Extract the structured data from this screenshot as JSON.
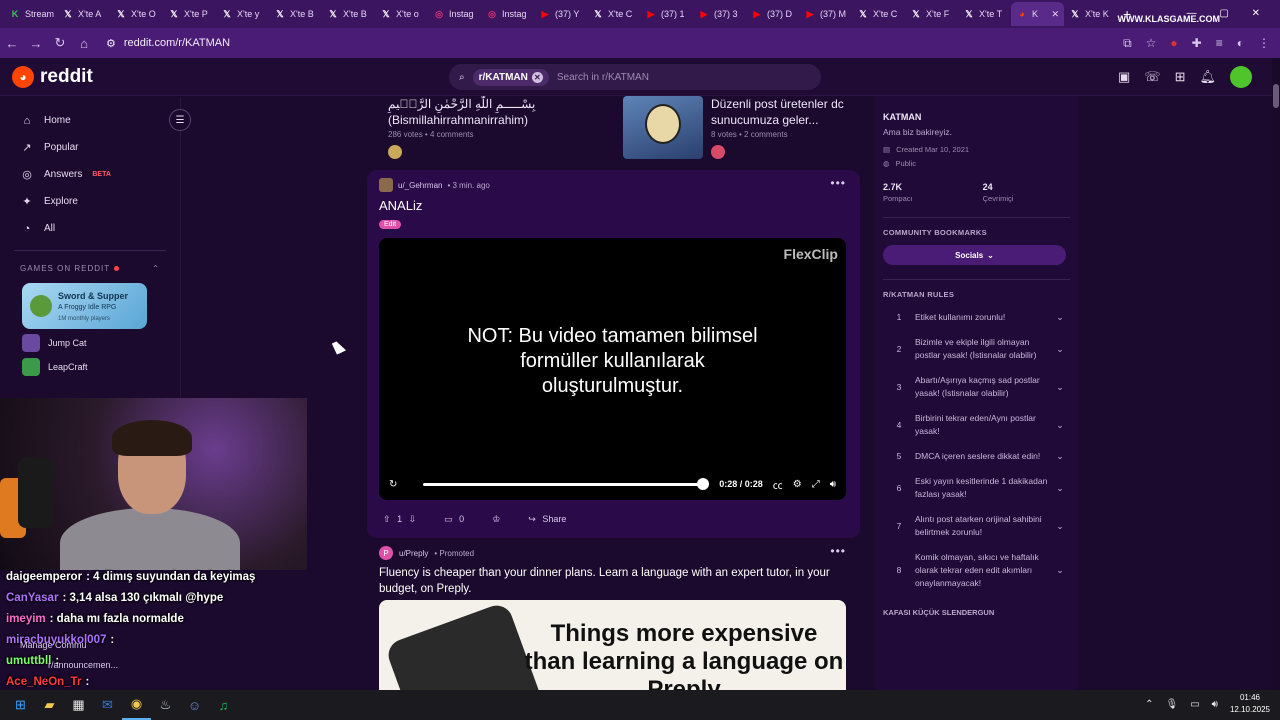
{
  "browser": {
    "tabs": [
      {
        "label": "Stream",
        "icon": "klas-icon",
        "color": "#2ecc40"
      },
      {
        "label": "X'te A",
        "icon": "x-icon",
        "color": "#ffffff"
      },
      {
        "label": "X'te O",
        "icon": "x-icon",
        "color": "#ffffff"
      },
      {
        "label": "X'te P",
        "icon": "x-icon",
        "color": "#ffffff"
      },
      {
        "label": "X'te y",
        "icon": "x-icon",
        "color": "#ffffff"
      },
      {
        "label": "X'te B",
        "icon": "x-icon",
        "color": "#ffffff"
      },
      {
        "label": "X'te B",
        "icon": "x-icon",
        "color": "#ffffff"
      },
      {
        "label": "X'te o",
        "icon": "x-icon",
        "color": "#ffffff"
      },
      {
        "label": "Instag",
        "icon": "instagram-icon",
        "color": "#e1306c"
      },
      {
        "label": "Instag",
        "icon": "instagram-icon",
        "color": "#e1306c"
      },
      {
        "label": "(37) Y",
        "icon": "youtube-icon",
        "color": "#ff0000"
      },
      {
        "label": "X'te C",
        "icon": "x-icon",
        "color": "#ffffff"
      },
      {
        "label": "(37) 1",
        "icon": "youtube-icon",
        "color": "#ff0000"
      },
      {
        "label": "(37) 3",
        "icon": "youtube-icon",
        "color": "#ff0000"
      },
      {
        "label": "(37) D",
        "icon": "youtube-icon",
        "color": "#ff0000"
      },
      {
        "label": "(37) M",
        "icon": "youtube-icon",
        "color": "#ff0000"
      },
      {
        "label": "X'te C",
        "icon": "x-icon",
        "color": "#ffffff"
      },
      {
        "label": "X'te F",
        "icon": "x-icon",
        "color": "#ffffff"
      },
      {
        "label": "X'te T",
        "icon": "x-icon",
        "color": "#ffffff"
      },
      {
        "label": "K",
        "icon": "reddit-icon",
        "color": "#ff4500",
        "active": true
      },
      {
        "label": "X'te K",
        "icon": "x-icon",
        "color": "#ffffff"
      }
    ],
    "brand_overlay": "WWW.KLASGAME.COM",
    "url": "reddit.com/r/KATMAN"
  },
  "header": {
    "logo_text": "reddit",
    "search_chip": "r/KATMAN",
    "search_placeholder": "Search in r/KATMAN",
    "notif_count": "1"
  },
  "left_nav": {
    "items": [
      {
        "label": "Home",
        "icon": "home-icon",
        "glyph": "⌂"
      },
      {
        "label": "Popular",
        "icon": "popular-icon",
        "glyph": "↗"
      },
      {
        "label": "Answers",
        "icon": "answers-icon",
        "glyph": "◎",
        "badge": "BETA"
      },
      {
        "label": "Explore",
        "icon": "explore-icon",
        "glyph": "✦"
      },
      {
        "label": "All",
        "icon": "all-icon",
        "glyph": "◔"
      }
    ],
    "games_header": "GAMES ON REDDIT",
    "featured_game": {
      "title": "Sword & Supper",
      "subtitle": "A Froggy Idle RPG",
      "players": "1M monthly players"
    },
    "games": [
      {
        "label": "Jump Cat",
        "color": "#6a4aa0"
      },
      {
        "label": "LeapCraft",
        "color": "#3a9a4a"
      }
    ]
  },
  "chat": {
    "lines": [
      {
        "user": "daigeemperor",
        "text": ": 4 dimış suyundan da keyimaş",
        "color": "#ffffff"
      },
      {
        "user": "CanYasar",
        "text": ": 3,14 alsa 130 çıkmalı @hype",
        "color": "#b070ff"
      },
      {
        "user": "imeyim",
        "text": ": daha mı fazla normalde",
        "color": "#ff6ad0"
      },
      {
        "user": "miracbuyukkol007",
        "text": ":",
        "color": "#b070ff"
      },
      {
        "user": "umuttbll",
        "text": ":",
        "color": "#7cff6a"
      },
      {
        "user": "Ace_NeOn_Tr",
        "text": ":",
        "color": "#ff3a3a"
      }
    ],
    "bg_items": [
      "Manage Commu",
      "r/announcemen..."
    ]
  },
  "feed": {
    "prev_left": {
      "title": "بِسْـــــمِ اللّٰهِ الرَّحْمٰنِ الرَّح۪يمِ (Bismillahirrahmanirrahim)",
      "meta": "286 votes • 4 comments"
    },
    "prev_right": {
      "title": "Düzenli post üretenler dc sunucumuza geler...",
      "meta": "8 votes • 2 comments"
    },
    "post": {
      "user": "u/_Gehrman",
      "time": "• 3 min. ago",
      "title": "ANALiz",
      "flair": "Edit",
      "watermark": "FlexClip",
      "video_text": "NOT: Bu video tamamen bilimsel formüller kullanılarak oluşturulmuştur.",
      "time_display": "0:28 / 0:28",
      "progress": 1.0,
      "votes": "1",
      "comments": "0",
      "share_label": "Share"
    },
    "promo": {
      "user": "u/Preply",
      "tag": "• Promoted",
      "title": "Fluency is cheaper than your dinner plans. Learn a language with an expert tutor, in your budget, on Preply.",
      "image_text": "Things more expensive than learning a language on Preply"
    }
  },
  "community": {
    "name": "KATMAN",
    "description": "Ama biz bakireyiz.",
    "created": "Created Mar 10, 2021",
    "visibility": "Public",
    "members": "2.7K",
    "members_label": "Pompacı",
    "online": "24",
    "online_label": "Çevrimiçi",
    "bookmarks_header": "COMMUNITY BOOKMARKS",
    "socials_label": "Socials",
    "rules_header": "R/KATMAN RULES",
    "rules": [
      {
        "n": "1",
        "text": "Etiket kullanımı zorunlu!"
      },
      {
        "n": "2",
        "text": "Bizimle ve ekiple ilgili olmayan postlar yasak! (İstisnalar olabilir)"
      },
      {
        "n": "3",
        "text": "Abartı/Aşırıya kaçmış sad postlar yasak! (İstisnalar olabilir)"
      },
      {
        "n": "4",
        "text": "Birbirini tekrar eden/Aynı postlar yasak!"
      },
      {
        "n": "5",
        "text": "DMCA içeren seslere dikkat edin!"
      },
      {
        "n": "6",
        "text": "Eski yayın kesitlerinde 1 dakikadan fazlası yasak!"
      },
      {
        "n": "7",
        "text": "Alıntı post atarken orijinal sahibini belirtmek zorunlu!"
      },
      {
        "n": "8",
        "text": "Komik olmayan, sıkıcı ve haftalık olarak tekrar eden edit akımları onaylanmayacak!"
      }
    ],
    "footer_header": "KAFASI KÜÇÜK SLENDERGUN"
  },
  "taskbar": {
    "apps": [
      {
        "icon": "windows-start-icon",
        "glyph": "⊞",
        "color": "#3aa0ff"
      },
      {
        "icon": "file-explorer-icon",
        "glyph": "▰",
        "color": "#f2c94c"
      },
      {
        "icon": "store-icon",
        "glyph": "▦",
        "color": "#e8e8e8"
      },
      {
        "icon": "outlook-icon",
        "glyph": "✉",
        "color": "#2f7bd8"
      },
      {
        "icon": "chrome-icon",
        "glyph": "◉",
        "color": "#f2c94c",
        "active": true
      },
      {
        "icon": "steam-icon",
        "glyph": "♨",
        "color": "#c8d8e8"
      },
      {
        "icon": "discord-icon",
        "glyph": "☺",
        "color": "#7289da"
      },
      {
        "icon": "spotify-icon",
        "glyph": "♫",
        "color": "#1db954"
      }
    ],
    "time": "01:46",
    "date": "12.10.2025"
  },
  "colors": {
    "accent": "#ff4500",
    "page_bg": "#1c0a2e",
    "post_bg": "#2a0a48"
  }
}
